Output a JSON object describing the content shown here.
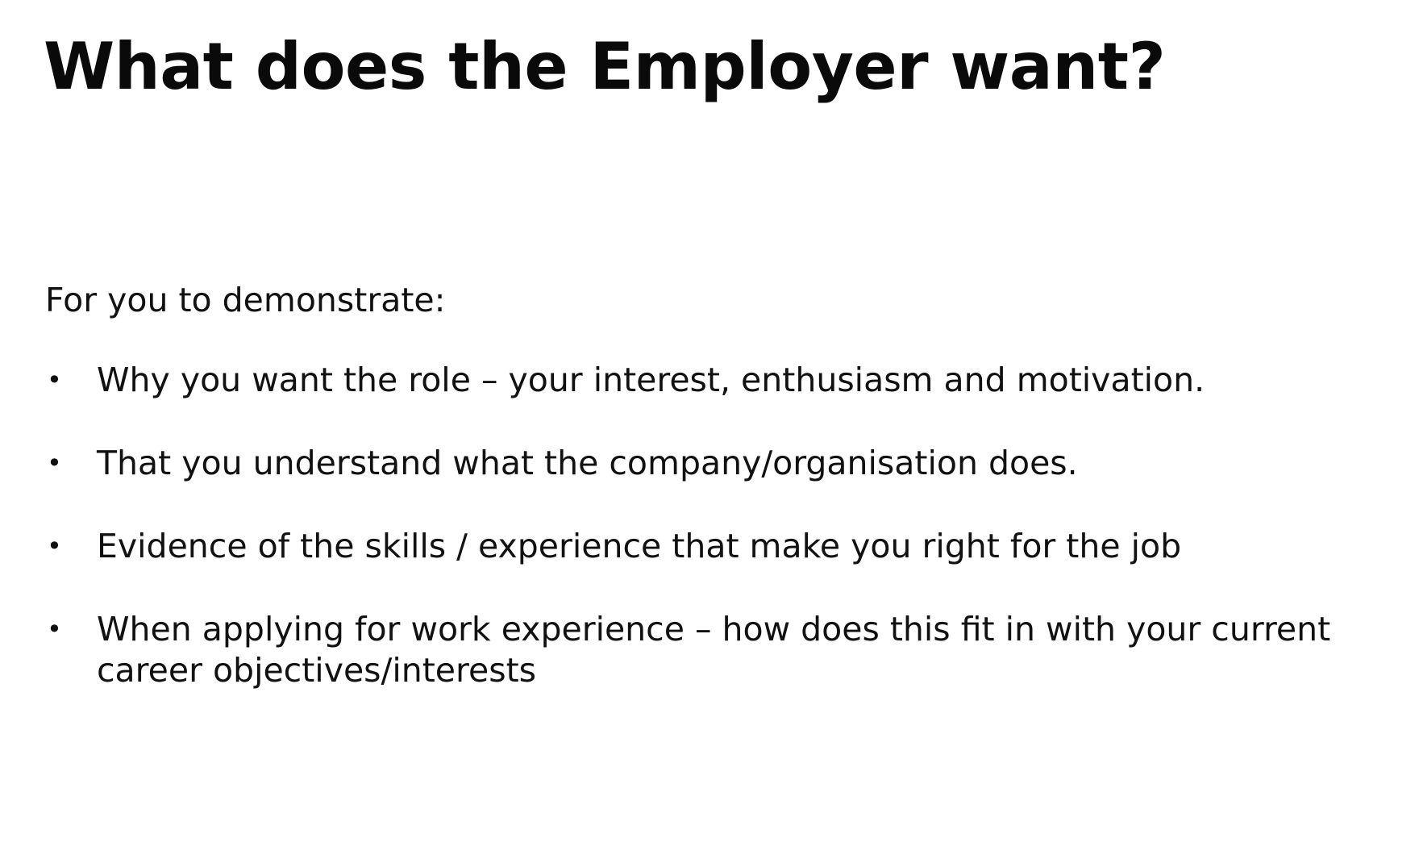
{
  "slide": {
    "title": "What does the Employer want?",
    "intro": "For you to demonstrate:",
    "bullet_symbol": "•",
    "bullets": [
      "Why you want the role – your interest, enthusiasm and motivation.",
      "That you understand what the company/organisation does.",
      "Evidence of the skills / experience that make you right for the job",
      "When applying for work experience – how does this fit in with your current career objectives/interests"
    ]
  }
}
